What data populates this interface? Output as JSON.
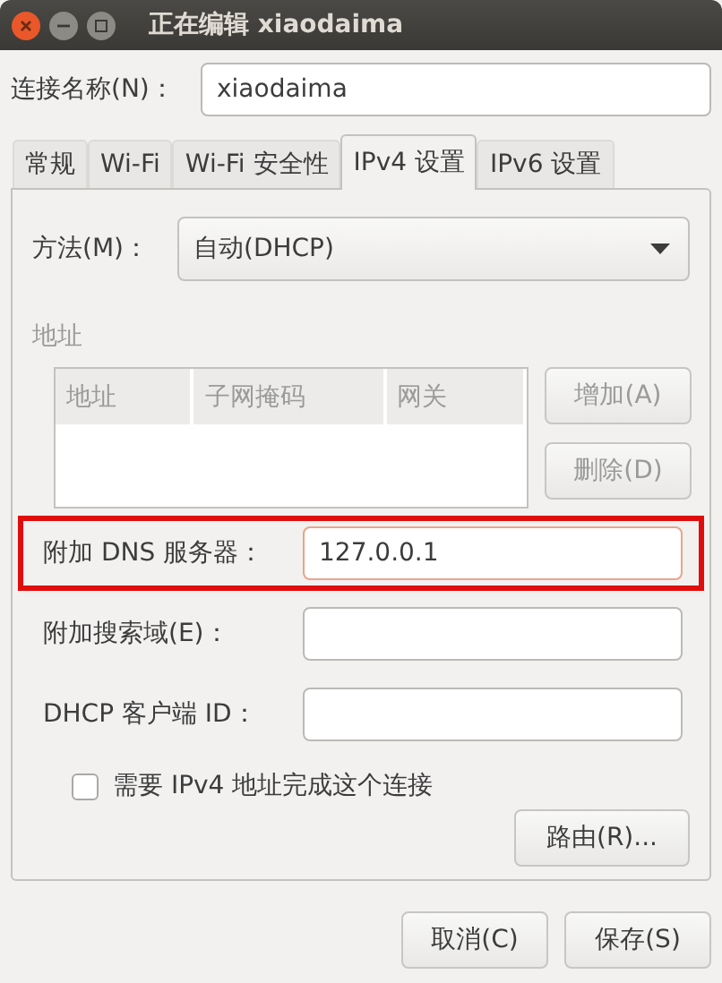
{
  "window": {
    "title": "正在编辑 xiaodaima"
  },
  "connection_name": {
    "label": "连接名称(N)：",
    "value": "xiaodaima"
  },
  "tabs": [
    {
      "label": "常规",
      "selected": false
    },
    {
      "label": "Wi-Fi",
      "selected": false
    },
    {
      "label": "Wi-Fi 安全性",
      "selected": false
    },
    {
      "label": "IPv4 设置",
      "selected": true
    },
    {
      "label": "IPv6 设置",
      "selected": false
    }
  ],
  "method": {
    "label": "方法(M)：",
    "value": "自动(DHCP)"
  },
  "address_section": {
    "title": "地址",
    "columns": [
      "地址",
      "子网掩码",
      "网关"
    ],
    "buttons": [
      {
        "label": "增加(A)",
        "disabled": true
      },
      {
        "label": "删除(D)",
        "disabled": true
      }
    ]
  },
  "fields": [
    {
      "label": "附加 DNS 服务器：",
      "value": "127.0.0.1",
      "focused": true,
      "highlighted": true
    },
    {
      "label": "附加搜索域(E)：",
      "focused": false,
      "highlighted": false
    },
    {
      "label": "DHCP 客户端 ID：",
      "focused": false,
      "highlighted": false
    }
  ],
  "require_ipv4": {
    "label": "需要 IPv4 地址完成这个连接",
    "checked": false
  },
  "routes_button": "路由(R)...",
  "buttons": [
    "取消(C)",
    "保存(S)"
  ]
}
